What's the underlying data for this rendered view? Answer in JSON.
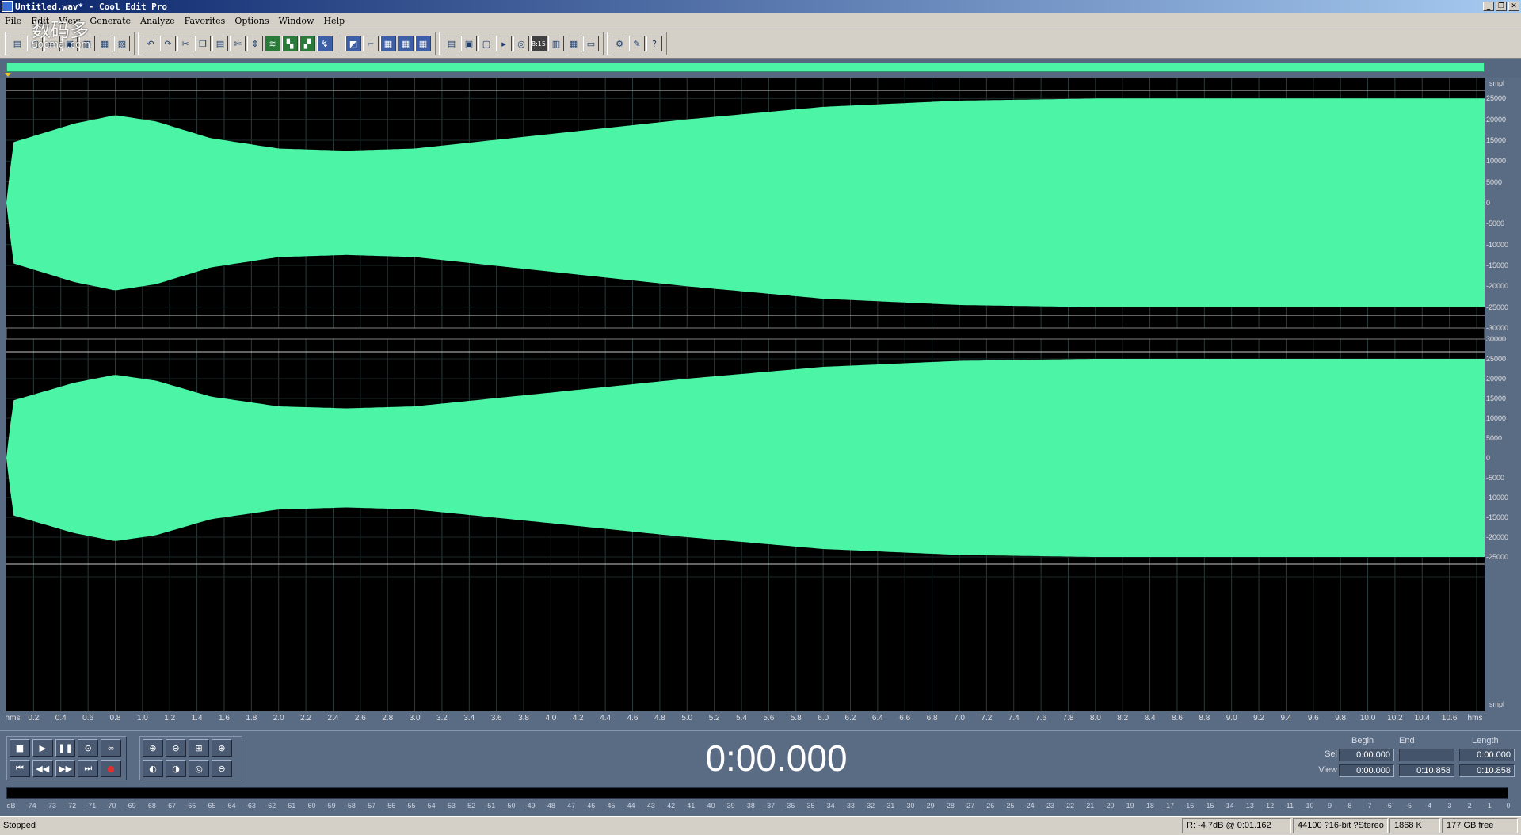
{
  "window": {
    "title": "Untitled.wav* - Cool Edit Pro",
    "buttons": [
      "_",
      "❐",
      "✕"
    ]
  },
  "menu": [
    "File",
    "Edit",
    "View",
    "Generate",
    "Analyze",
    "Favorites",
    "Options",
    "Window",
    "Help"
  ],
  "watermark": {
    "main": "数码多",
    "sub": "Soomal.com"
  },
  "waveform": {
    "color": "#4cf5a6",
    "background": "#000000",
    "channels": 2,
    "y_unit": "smpl",
    "y_ticks_top": [
      "25000",
      "20000",
      "15000",
      "10000",
      "5000",
      "0",
      "-5000",
      "-10000",
      "-15000",
      "-20000",
      "-25000",
      "-30000"
    ],
    "y_ticks_bottom": [
      "30000",
      "25000",
      "20000",
      "15000",
      "10000",
      "5000",
      "0",
      "-5000",
      "-10000",
      "-15000",
      "-20000",
      "-25000"
    ],
    "envelope_amplitude": {
      "time_s": [
        0.0,
        0.05,
        0.2,
        0.5,
        0.8,
        1.1,
        1.5,
        2.0,
        2.5,
        3.0,
        4.0,
        5.0,
        6.0,
        7.0,
        8.0,
        9.0,
        10.0,
        10.858
      ],
      "value": [
        0,
        14500,
        16000,
        19000,
        21000,
        19500,
        15500,
        13000,
        12500,
        13000,
        16500,
        20000,
        23000,
        24500,
        25000,
        25000,
        25000,
        25000
      ]
    }
  },
  "time_axis": {
    "unit_label": "hms",
    "ticks": [
      "0.2",
      "0.4",
      "0.6",
      "0.8",
      "1.0",
      "1.2",
      "1.4",
      "1.6",
      "1.8",
      "2.0",
      "2.2",
      "2.4",
      "2.6",
      "2.8",
      "3.0",
      "3.2",
      "3.4",
      "3.6",
      "3.8",
      "4.0",
      "4.2",
      "4.4",
      "4.6",
      "4.8",
      "5.0",
      "5.2",
      "5.4",
      "5.6",
      "5.8",
      "6.0",
      "6.2",
      "6.4",
      "6.6",
      "6.8",
      "7.0",
      "7.2",
      "7.4",
      "7.6",
      "7.8",
      "8.0",
      "8.2",
      "8.4",
      "8.6",
      "8.8",
      "9.0",
      "9.2",
      "9.4",
      "9.6",
      "9.8",
      "10.0",
      "10.2",
      "10.4",
      "10.6"
    ],
    "end_label": "hms"
  },
  "transport": {
    "row1": [
      "■",
      "▶",
      "❚❚",
      "⊙",
      "∞"
    ],
    "row2": [
      "⏮",
      "◀◀",
      "▶▶",
      "⏭",
      "●"
    ]
  },
  "time_display": "0:00.000",
  "selection": {
    "headers": {
      "begin": "Begin",
      "end": "End",
      "length": "Length"
    },
    "sel": {
      "label": "Sel",
      "begin": "0:00.000",
      "end": "",
      "length": "0:00.000"
    },
    "view": {
      "label": "View",
      "begin": "0:00.000",
      "end": "0:10.858",
      "length": "0:10.858"
    }
  },
  "level_meter": {
    "scale": [
      "dB",
      "-74",
      "-73",
      "-72",
      "-71",
      "-70",
      "-69",
      "-68",
      "-67",
      "-66",
      "-65",
      "-64",
      "-63",
      "-62",
      "-61",
      "-60",
      "-59",
      "-58",
      "-57",
      "-56",
      "-55",
      "-54",
      "-53",
      "-52",
      "-51",
      "-50",
      "-49",
      "-48",
      "-47",
      "-46",
      "-45",
      "-44",
      "-43",
      "-42",
      "-41",
      "-40",
      "-39",
      "-38",
      "-37",
      "-36",
      "-35",
      "-34",
      "-33",
      "-32",
      "-31",
      "-30",
      "-29",
      "-28",
      "-27",
      "-26",
      "-25",
      "-24",
      "-23",
      "-22",
      "-21",
      "-20",
      "-19",
      "-18",
      "-17",
      "-16",
      "-15",
      "-14",
      "-13",
      "-12",
      "-11",
      "-10",
      "-9",
      "-8",
      "-7",
      "-6",
      "-5",
      "-4",
      "-3",
      "-2",
      "-1",
      "0"
    ]
  },
  "status": {
    "state": "Stopped",
    "cursor": "R: -4.7dB @   0:01.162",
    "format": "44100 ?16-bit ?Stereo",
    "size": "1868 K",
    "free": "177 GB free"
  }
}
